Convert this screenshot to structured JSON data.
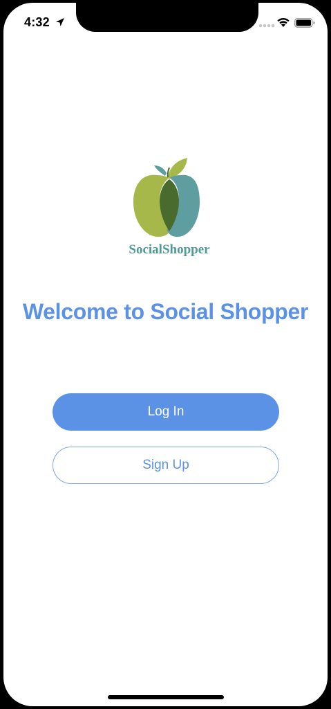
{
  "status_bar": {
    "time": "4:32",
    "icons": [
      "location-arrow-icon",
      "signal-icon",
      "wifi-icon",
      "battery-icon"
    ]
  },
  "logo": {
    "brand_text": "SocialShopper",
    "colors": {
      "green": "#a6b84a",
      "teal": "#5f9ea0",
      "overlap": "#4a6b2e",
      "text": "#4f9a96"
    }
  },
  "welcome": {
    "title": "Welcome to Social Shopper"
  },
  "buttons": {
    "login_label": "Log In",
    "signup_label": "Sign Up"
  },
  "theme": {
    "accent": "#5b92e5",
    "background": "#ffffff"
  }
}
